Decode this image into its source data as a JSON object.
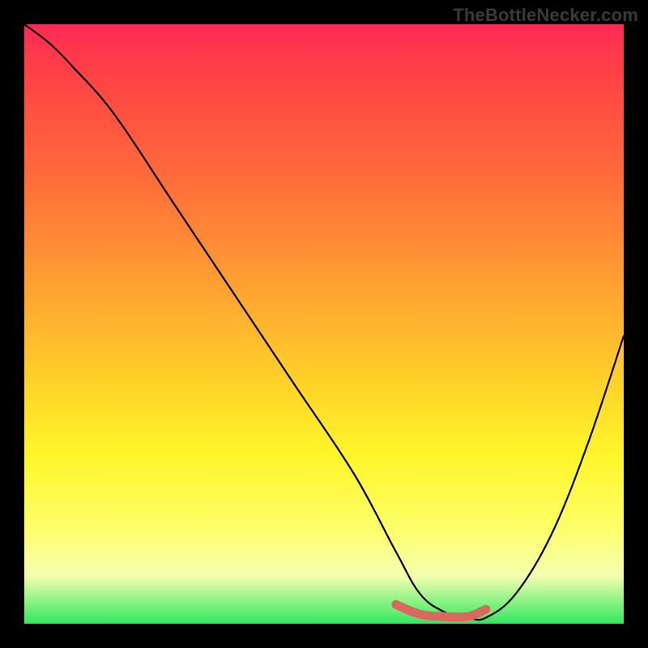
{
  "watermark": "TheBottleNecker.com",
  "colors": {
    "frame_bg": "#000000",
    "watermark_color": "#3a3a3a",
    "gradient_stops": [
      {
        "pos": 0,
        "color": "#ff2a55"
      },
      {
        "pos": 8,
        "color": "#ff4146"
      },
      {
        "pos": 25,
        "color": "#ff6a3a"
      },
      {
        "pos": 45,
        "color": "#ffa531"
      },
      {
        "pos": 60,
        "color": "#ffd328"
      },
      {
        "pos": 72,
        "color": "#fff62a"
      },
      {
        "pos": 84,
        "color": "#feff69"
      },
      {
        "pos": 92,
        "color": "#f4ffb0"
      },
      {
        "pos": 100,
        "color": "#30e85f"
      }
    ],
    "curve_color": "#000000",
    "highlight_color": "#d9695f"
  },
  "chart_data": {
    "type": "line",
    "title": "",
    "xlabel": "",
    "ylabel": "",
    "xlim": [
      0,
      100
    ],
    "ylim": [
      0,
      100
    ],
    "series": [
      {
        "name": "bottleneck-curve",
        "x": [
          0,
          4,
          8,
          15,
          25,
          35,
          45,
          55,
          62,
          66,
          70,
          74,
          77,
          82,
          88,
          94,
          100
        ],
        "y": [
          100,
          97,
          93,
          85,
          70,
          55,
          40,
          25,
          12,
          5,
          2,
          1,
          1,
          5,
          15,
          30,
          48
        ]
      }
    ],
    "highlight_segment": {
      "name": "optimal-range",
      "x": [
        62,
        66,
        70,
        74,
        77
      ],
      "y": [
        3.2,
        1.6,
        1.2,
        1.2,
        2.4
      ]
    },
    "grid": false,
    "legend": false
  }
}
